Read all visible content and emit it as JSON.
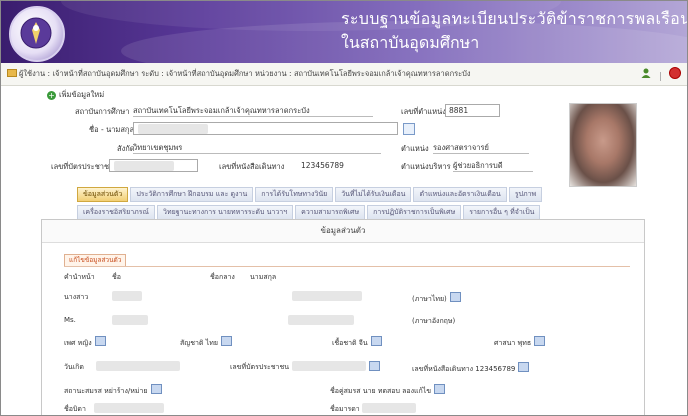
{
  "header": {
    "title_line1": "ระบบฐานข้อมูลทะเบียนประวัติข้าราชการพลเรือน",
    "title_line2": "ในสถาบันอุดมศึกษา",
    "logo_icon": "university-seal-icon"
  },
  "breadcrumb": {
    "text": "ผู้ใช้งาน : เจ้าหน้าที่สถาบันอุดมศึกษา ระดับ : เจ้าหน้าที่สถาบันอุดมศึกษา หน่วยงาน : สถาบันเทคโนโลยีพระจอมเกล้าเจ้าคุณทหารลาดกระบัง"
  },
  "form": {
    "add_new_label": "เพิ่มข้อมูลใหม่",
    "institution_label": "สถาบันการศึกษา",
    "institution_value": "สถาบันเทคโนโลยีพระจอมเกล้าเจ้าคุณทหารลาดกระบัง",
    "position_no_label": "เลขที่ตำแหน่ง",
    "position_no_value": "8881",
    "name_label": "ชื่อ - นามสกุล",
    "affiliation_label": "สังกัด",
    "affiliation_value": "วิทยาเขตชุมพร",
    "position_label": "ตำแหน่ง",
    "position_value": "รองศาสตราจารย์",
    "citizen_id_label": "เลขที่บัตรประชาชน",
    "passport_label": "เลขที่หนังสือเดินทาง",
    "passport_value": "123456789",
    "admin_position_label": "ตำแหน่งบริหาร",
    "admin_position_value": "ผู้ช่วยอธิการบดี"
  },
  "tabs": {
    "row1": [
      "ข้อมูลส่วนตัว",
      "ประวัติการศึกษา ฝึกอบรม และ ดูงาน",
      "การได้รับโทษทางวินัย",
      "วันที่ไม่ได้รับเงินเดือน",
      "ตำแหน่งและอัตราเงินเดือน",
      "รูปภาพ"
    ],
    "row2": [
      "เครื่องราชอิสริยาภรณ์",
      "วิทยฐานะทางการ นายทหารระดับ นาวาฯ",
      "ความสามารถพิเศษ",
      "การปฏิบัติราชการเป็นพิเศษ",
      "รายการอื่น ๆ ที่จำเป็น"
    ]
  },
  "panel": {
    "title": "ข้อมูลส่วนตัว",
    "edit_tab": "แก้ไขข้อมูลส่วนตัว",
    "prefix_label": "คำนำหน้า",
    "first_name_label": "ชื่อ",
    "middle_name_label": "ชื่อกลาง",
    "last_name_label": "นามสกุล",
    "prefix_th": "นางสาว",
    "thai_lang": "(ภาษาไทย)",
    "prefix_en": "Ms.",
    "eng_lang": "(ภาษาอังกฤษ)",
    "sex": "เพศ หญิง",
    "nationality": "สัญชาติ ไทย",
    "race": "เชื้อชาติ จีน",
    "religion": "ศาสนา พุทธ",
    "birthdate_label": "วันเกิด",
    "citizen_id_label": "เลขที่บัตรประชาชน",
    "passport": "เลขที่หนังสือเดินทาง 123456789",
    "marital": "สถานะสมรส หย่าร้าง/หม่าย",
    "spouse": "ชื่อคู่สมรส นาย ทดสอบ ลองแก้ไข",
    "father_label": "ชื่อบิดา",
    "mother_label": "ชื่อมารดา"
  }
}
